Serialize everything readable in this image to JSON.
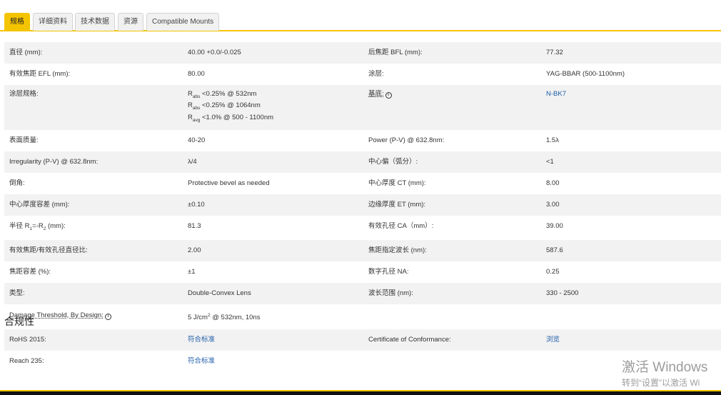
{
  "tabs": [
    {
      "label": "规格"
    },
    {
      "label": "详细资料"
    },
    {
      "label": "技术数据"
    },
    {
      "label": "资源"
    },
    {
      "label": "Compatible Mounts"
    }
  ],
  "specs": {
    "r1": {
      "l1": "直径 (mm):",
      "v1": "40.00 +0.0/-0.025",
      "l2": "后焦距 BFL (mm):",
      "v2": "77.32"
    },
    "r2": {
      "l1": "有效焦距 EFL (mm):",
      "v1": "80.00",
      "l2": "涂层:",
      "v2": "YAG-BBAR (500-1100nm)"
    },
    "r3": {
      "l1": "涂层规格:",
      "line1_value": "<0.25% @ 532nm",
      "line2_value": "<0.25% @ 1064nm",
      "line3_value": "<1.0% @ 500 - 1100nm",
      "sub_abs": "abs",
      "sub_avg": "avg",
      "r": "R",
      "l2": "基底:",
      "v2": "N-BK7",
      "info_icon": "info-icon"
    },
    "r4": {
      "l1": "表面质量:",
      "v1": "40-20",
      "l2": "Power (P-V) @ 632.8nm:",
      "v2": "1.5λ"
    },
    "r5": {
      "l1": "Irregularity (P-V) @ 632.8nm:",
      "v1": "λ/4",
      "l2": "中心偏（弧分）:",
      "v2": "<1"
    },
    "r6": {
      "l1": "倒角:",
      "v1": "Protective bevel as needed",
      "l2": "中心厚度 CT (mm):",
      "v2": "8.00"
    },
    "r7": {
      "l1": "中心厚度容差 (mm):",
      "v1": "±0.10",
      "l2": "边缘厚度 ET (mm):",
      "v2": "3.00"
    },
    "r8": {
      "l1_prefix": "半径 R",
      "l1_sub1": "1",
      "l1_mid": "=-R",
      "l1_sub2": "2",
      "l1_suffix": " (mm):",
      "v1": "81.3",
      "l2": "有效孔径 CA（mm）:",
      "v2": "39.00"
    },
    "r9": {
      "l1": "有效焦距/有效孔径直径比:",
      "v1": "2.00",
      "l2": "焦距指定波长 (nm):",
      "v2": "587.6"
    },
    "r10": {
      "l1": "焦距容差 (%):",
      "v1": "±1",
      "l2": "数字孔径 NA:",
      "v2": "0.25"
    },
    "r11": {
      "l1": "类型:",
      "v1": "Double-Convex Lens",
      "l2": "波长范围 (nm):",
      "v2": "330 - 2500"
    },
    "r12": {
      "l1": "Damage Threshold, By Design:",
      "v1_prefix": "5 J/cm",
      "v1_sup": "2",
      "v1_suffix": " @ 532nm, 10ns"
    }
  },
  "compliance": {
    "title": "合规性",
    "r1": {
      "l1": "RoHS 2015:",
      "v1": "符合标准",
      "l2": "Certificate of Conformance:",
      "v2": "浏览"
    },
    "r2": {
      "l1": "Reach 235:",
      "v1": "符合标准"
    }
  },
  "activation": {
    "line1": "激活 Windows",
    "line2": "转到“设置”以激活 Wi"
  },
  "colors": {
    "accent": "#f5c400",
    "link": "#1f5ea8",
    "row_shade": "#f2f2f2"
  }
}
